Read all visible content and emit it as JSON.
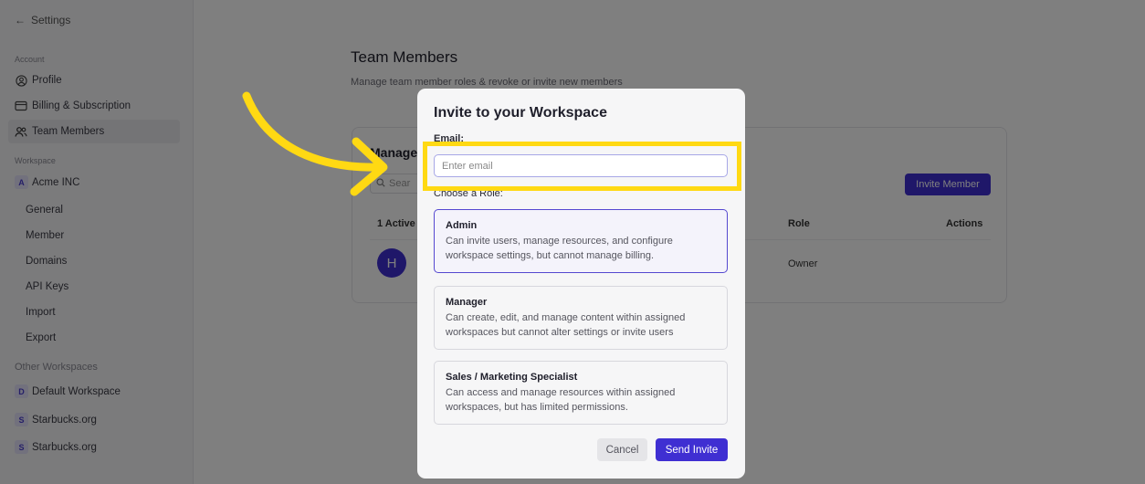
{
  "sidebar": {
    "back_label": "Settings",
    "account_section": "Account",
    "account_items": [
      {
        "label": "Profile",
        "icon": "user-circle-icon"
      },
      {
        "label": "Billing & Subscription",
        "icon": "credit-card-icon"
      },
      {
        "label": "Team Members",
        "icon": "users-icon"
      }
    ],
    "workspace_section": "Workspace",
    "current_workspace": {
      "badge": "A",
      "name": "Acme INC"
    },
    "workspace_items": [
      "General",
      "Member",
      "Domains",
      "API Keys",
      "Import",
      "Export"
    ],
    "other_section": "Other Workspaces",
    "other_workspaces": [
      {
        "badge": "D",
        "name": "Default Workspace"
      },
      {
        "badge": "S",
        "name": "Starbucks.org"
      },
      {
        "badge": "S",
        "name": "Starbucks.org"
      }
    ]
  },
  "main": {
    "title": "Team Members",
    "subtitle": "Manage team member roles & revoke or invite new members",
    "card_title": "Manage",
    "search_placeholder": "Sear",
    "invite_button": "Invite Member",
    "columns": [
      "1 Active",
      "Role",
      "Actions"
    ],
    "row": {
      "avatar": "H",
      "role": "Owner"
    }
  },
  "modal": {
    "title": "Invite to your Workspace",
    "email_label": "Email:",
    "email_placeholder": "Enter email",
    "role_label": "Choose a Role:",
    "roles": [
      {
        "title": "Admin",
        "desc": "Can invite users, manage resources, and configure workspace settings, but cannot manage billing."
      },
      {
        "title": "Manager",
        "desc": "Can create, edit, and manage content within assigned workspaces but cannot alter settings or invite users"
      },
      {
        "title": "Sales / Marketing Specialist",
        "desc": "Can access and manage resources within assigned workspaces, but has limited permissions."
      }
    ],
    "selected_role": "Admin",
    "cancel_label": "Cancel",
    "send_label": "Send Invite"
  },
  "colors": {
    "accent": "#3f2fd2",
    "highlight": "#ffd913"
  }
}
